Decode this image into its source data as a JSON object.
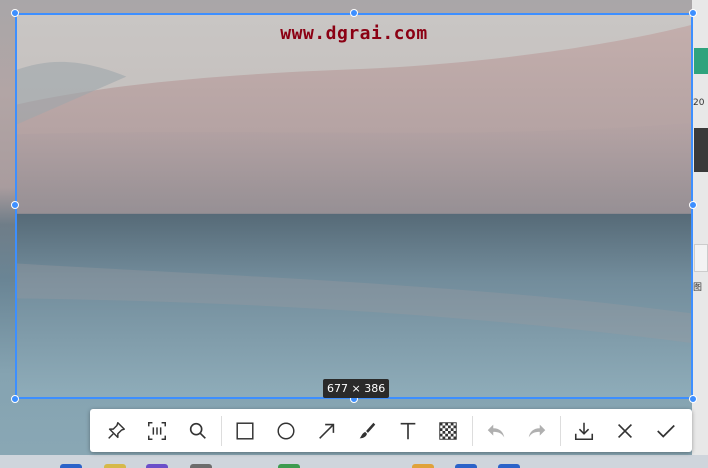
{
  "watermark": "www.dgrai.com",
  "selection": {
    "size_label": "677 × 386"
  },
  "desktop": {
    "right_text_1": "20",
    "right_text_2": "图"
  },
  "toolbar": {
    "tools": [
      {
        "name": "pin-tool",
        "icon": "pin-icon"
      },
      {
        "name": "ocr-tool",
        "icon": "text-scan-icon"
      },
      {
        "name": "magnify-tool",
        "icon": "search-icon"
      },
      {
        "name": "rectangle-tool",
        "icon": "rectangle-icon"
      },
      {
        "name": "ellipse-tool",
        "icon": "ellipse-icon"
      },
      {
        "name": "arrow-tool",
        "icon": "arrow-icon"
      },
      {
        "name": "brush-tool",
        "icon": "brush-icon"
      },
      {
        "name": "text-tool",
        "icon": "text-icon"
      },
      {
        "name": "mosaic-tool",
        "icon": "mosaic-icon"
      },
      {
        "name": "undo-button",
        "icon": "undo-icon",
        "disabled": true
      },
      {
        "name": "redo-button",
        "icon": "redo-icon",
        "disabled": true
      },
      {
        "name": "save-button",
        "icon": "download-icon"
      },
      {
        "name": "cancel-button",
        "icon": "close-icon"
      },
      {
        "name": "confirm-button",
        "icon": "check-icon"
      }
    ]
  },
  "colors": {
    "selection_border": "#3d8fff",
    "watermark": "#8b0013",
    "icon": "#333333",
    "icon_disabled": "#b0b0b0"
  }
}
